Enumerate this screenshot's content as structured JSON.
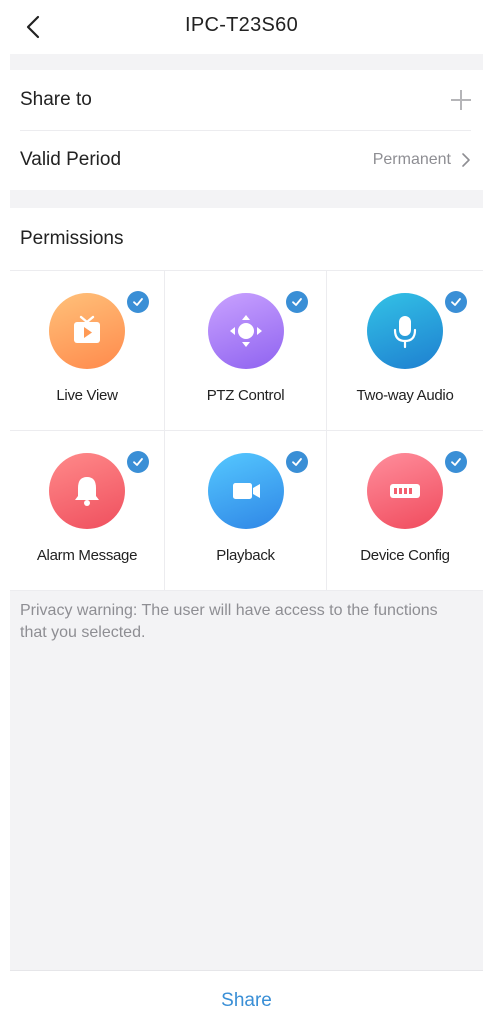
{
  "header": {
    "title": "IPC-T23S60"
  },
  "share_to": {
    "label": "Share to"
  },
  "valid_period": {
    "label": "Valid Period",
    "value": "Permanent"
  },
  "permissions": {
    "title": "Permissions",
    "items": [
      {
        "label": "Live View",
        "icon": "tv-icon",
        "checked": true,
        "gradient": [
          "#ffc17a",
          "#ff8a4c"
        ]
      },
      {
        "label": "PTZ Control",
        "icon": "ptz-direction-icon",
        "checked": true,
        "gradient": [
          "#c9a2ff",
          "#8f63f0"
        ]
      },
      {
        "label": "Two-way Audio",
        "icon": "microphone-icon",
        "checked": true,
        "gradient": [
          "#33c2e6",
          "#1e7fd0"
        ]
      },
      {
        "label": "Alarm Message",
        "icon": "bell-icon",
        "checked": true,
        "gradient": [
          "#ff8a8a",
          "#ef4f5e"
        ]
      },
      {
        "label": "Playback",
        "icon": "video-camera-icon",
        "checked": true,
        "gradient": [
          "#55c8ff",
          "#2f86e6"
        ]
      },
      {
        "label": "Device Config",
        "icon": "device-config-icon",
        "checked": true,
        "gradient": [
          "#ff8e9c",
          "#f04b5d"
        ]
      }
    ]
  },
  "warning": "Privacy warning: The user will have access to the functions that you selected.",
  "footer": {
    "share_label": "Share"
  },
  "colors": {
    "accent": "#3a8fd6",
    "page_bg": "#f3f3f5",
    "secondary_text": "#8e8e93"
  }
}
